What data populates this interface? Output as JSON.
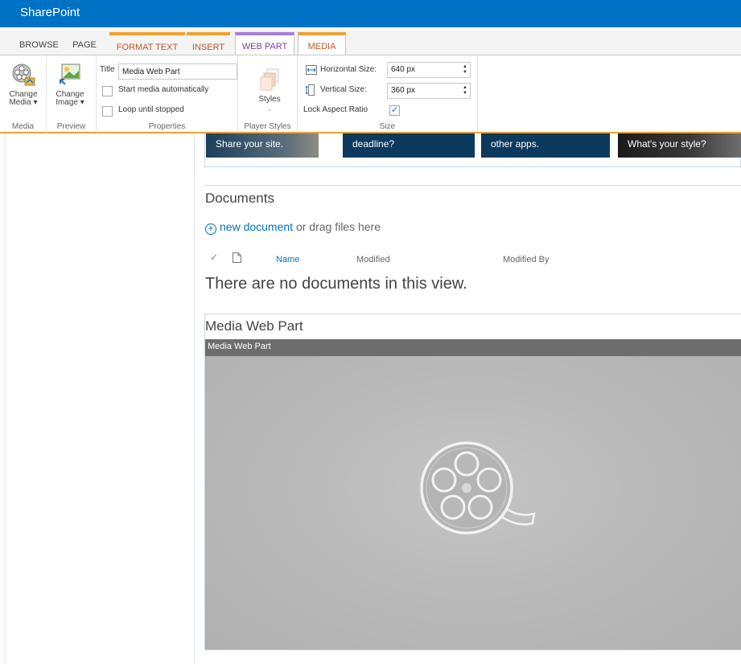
{
  "suite_bar": {
    "brand": "SharePoint"
  },
  "ribbon_tabs": [
    "BROWSE",
    "PAGE",
    "FORMAT TEXT",
    "INSERT",
    "WEB PART",
    "MEDIA"
  ],
  "ribbon": {
    "media_group": {
      "label": "Media",
      "change_media": "Change Media"
    },
    "preview_group": {
      "label": "Preview",
      "change_image": "Change Image"
    },
    "properties_group": {
      "label": "Properties",
      "title_label": "Title",
      "title_value": "Media Web Part",
      "start_auto": "Start media automatically",
      "loop": "Loop until stopped"
    },
    "player_styles_group": {
      "label": "Player Styles",
      "styles": "Styles"
    },
    "size_group": {
      "label": "Size",
      "horizontal_label": "Horizontal Size:",
      "horizontal_value": "640 px",
      "vertical_label": "Vertical Size:",
      "vertical_value": "360 px",
      "lock_label": "Lock Aspect Ratio",
      "lock_checked": true
    }
  },
  "promo_tiles": [
    "Share your site.",
    "deadline?",
    "other apps.",
    "What's your style?"
  ],
  "documents": {
    "title": "Documents",
    "new_link": "new document",
    "new_suffix": " or drag files here",
    "columns": {
      "name": "Name",
      "modified": "Modified",
      "modified_by": "Modified By"
    },
    "empty_message": "There are no documents in this view."
  },
  "media_webpart": {
    "title": "Media Web Part",
    "bar_title": "Media Web Part"
  },
  "colors": {
    "suite": "#0072c6",
    "accent_orange": "#f0a030",
    "accent_purple": "#a77cd6",
    "tile_bg": "#0b3a5e"
  }
}
